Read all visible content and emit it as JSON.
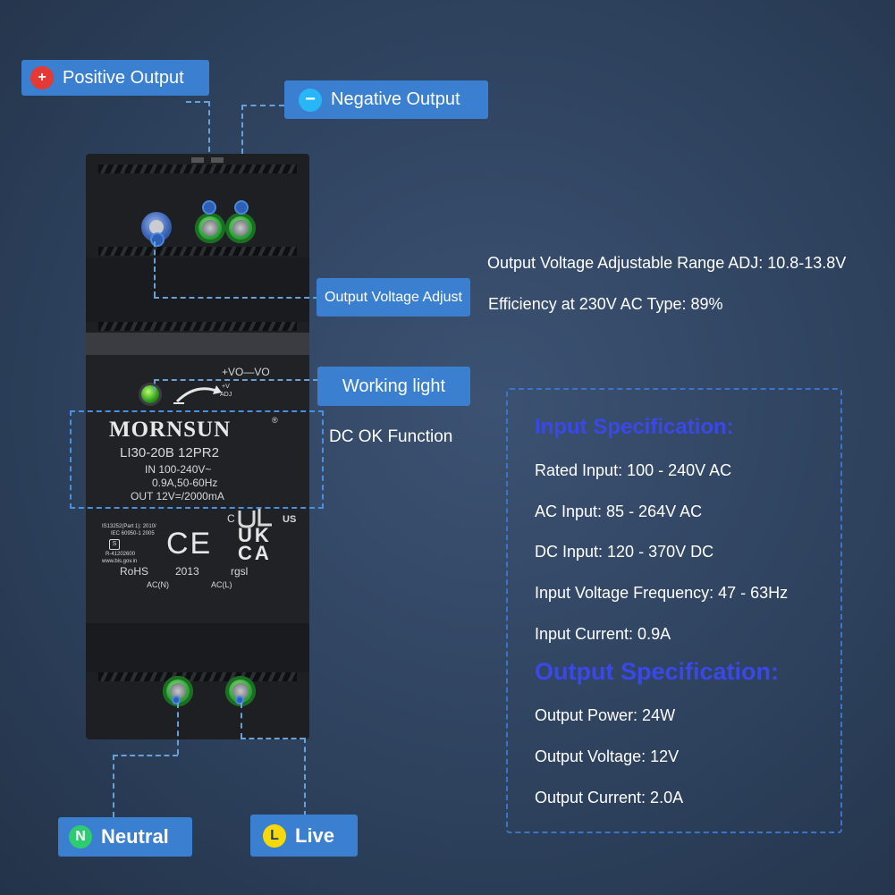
{
  "callouts": {
    "positive": {
      "badge": "+",
      "label": "Positive Output"
    },
    "negative": {
      "badge": "−",
      "label": "Negative Output"
    },
    "adjust": {
      "label": "Output Voltage Adjust"
    },
    "working": {
      "label": "Working light"
    },
    "neutral": {
      "badge": "N",
      "label": "Neutral"
    },
    "live": {
      "badge": "L",
      "label": "Live"
    }
  },
  "dc_ok_label": "DC OK Function",
  "info_lines": {
    "adj_range": "Output Voltage Adjustable Range ADJ: 10.8-13.8V",
    "efficiency": "Efficiency at 230V AC Type: 89%"
  },
  "device": {
    "adj_marking": "+VO—VO",
    "adj_plus": "+V",
    "adj_small": "ADJ",
    "brand": "MORNSUN",
    "registered": "®",
    "model": "LI30-20B 12PR2",
    "input_line1": "IN 100-240V~",
    "input_line2": "0.9A,50-60Hz",
    "output_line": "OUT 12V=/2000mA",
    "ul_c": "C",
    "ul_us": "US",
    "std1": "IS13252(Part 1): 2010/",
    "std2": "IEC 60950-1 2005",
    "reg_no": "R-41202600",
    "site": "www.bis.gov.in",
    "ce": "CE",
    "ukca_top": "UK",
    "ukca_bottom": "CA",
    "rohs": "RoHS",
    "year": "2013",
    "rgsl": "rgsl",
    "acn": "AC(N)",
    "acl": "AC(L)"
  },
  "input_spec": {
    "heading": "Input Specification:",
    "lines": [
      "Rated Input: 100 - 240V AC",
      "AC Input: 85 - 264V AC",
      "DC Input: 120 - 370V DC",
      "Input Voltage Frequency: 47 - 63Hz",
      "Input Current: 0.9A"
    ]
  },
  "output_spec": {
    "heading": "Output Specification:",
    "lines": [
      "Output Power: 24W",
      "Output Voltage: 12V",
      "Output Current: 2.0A"
    ]
  },
  "colors": {
    "callout": "#3a7fd0",
    "spec_heading": "#3a48e8",
    "positive_badge": "#e53935",
    "negative_badge": "#29b6f6",
    "neutral_badge": "#2ecc71",
    "live_badge": "#f5d90a"
  }
}
